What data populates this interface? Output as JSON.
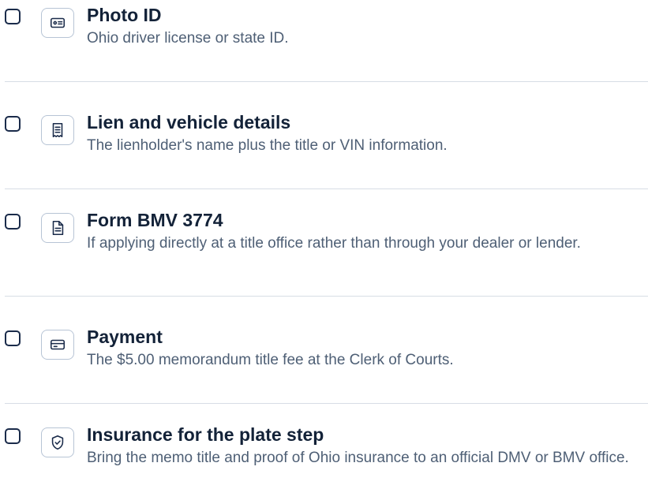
{
  "checklist": {
    "items": [
      {
        "title": "Photo ID",
        "description": "Ohio driver license or state ID.",
        "icon": "id-card-icon",
        "checked": false
      },
      {
        "title": "Lien and vehicle details",
        "description": "The lienholder's name plus the title or VIN information.",
        "icon": "receipt-icon",
        "checked": false
      },
      {
        "title": "Form BMV 3774",
        "description": "If applying directly at a title office rather than through your dealer or lender.",
        "icon": "document-icon",
        "checked": false
      },
      {
        "title": "Payment",
        "description": "The $5.00 memorandum title fee at the Clerk of Courts.",
        "icon": "credit-card-icon",
        "checked": false
      },
      {
        "title": "Insurance for the plate step",
        "description": "Bring the memo title and proof of Ohio insurance to an official DMV or BMV office.",
        "icon": "shield-check-icon",
        "checked": false
      }
    ]
  },
  "colors": {
    "title": "#132238",
    "description": "#4e5f75",
    "border": "#b7c4d5",
    "divider": "#d7dde5"
  }
}
